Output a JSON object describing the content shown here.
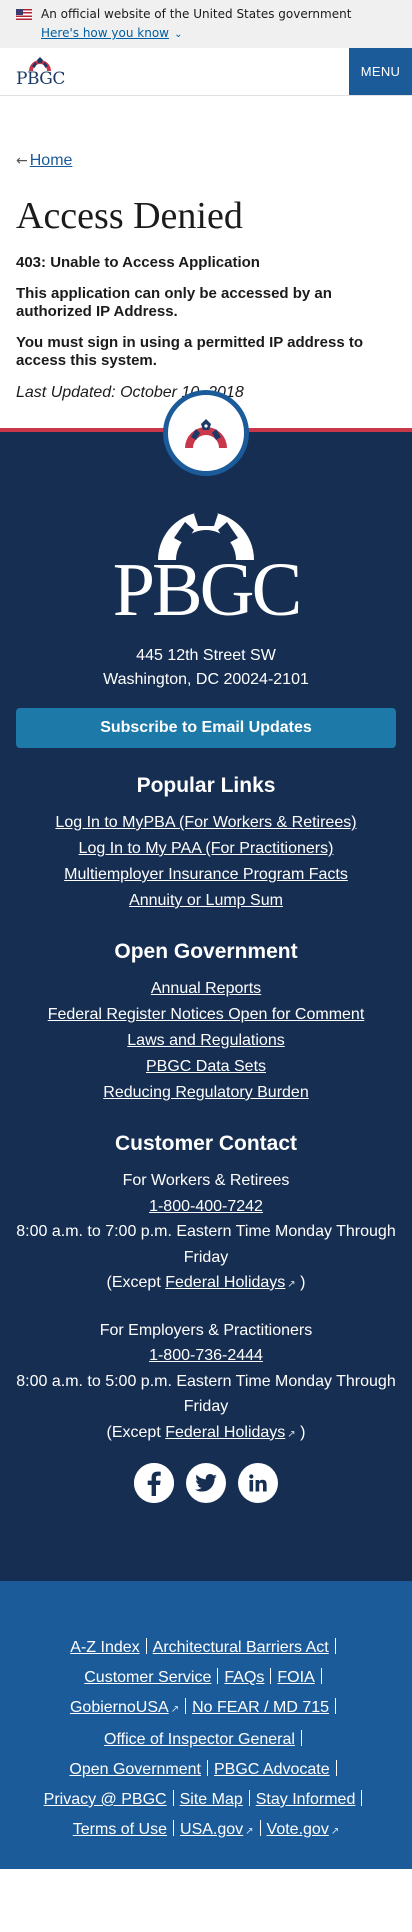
{
  "gov_banner": {
    "text": "An official website of the United States government",
    "link": "Here's how you know"
  },
  "header": {
    "logo_text": "PBGC",
    "menu_label": "MENU"
  },
  "breadcrumb": {
    "home": "Home"
  },
  "page": {
    "title": "Access Denied",
    "error_code": "403: Unable to Access Application",
    "message_1": "This application can only be accessed by an authorized IP Address.",
    "message_2": "You must sign in using a permitted IP address to access this system.",
    "last_updated": "Last Updated: October 10, 2018"
  },
  "footer": {
    "logo_text": "PBGC",
    "address_line_1": "445 12th Street SW",
    "address_line_2": "Washington, DC 20024-2101",
    "subscribe_label": "Subscribe to Email Updates",
    "popular_links": {
      "heading": "Popular Links",
      "items": [
        "Log In to MyPBA (For Workers & Retirees)",
        "Log In to My PAA (For Practitioners)",
        "Multiemployer Insurance Program Facts",
        "Annuity or Lump Sum"
      ]
    },
    "open_government": {
      "heading": "Open Government",
      "items": [
        "Annual Reports",
        "Federal Register Notices Open for Comment",
        "Laws and Regulations",
        "PBGC Data Sets",
        "Reducing Regulatory Burden"
      ]
    },
    "customer_contact": {
      "heading": "Customer Contact",
      "workers": {
        "label": "For Workers & Retirees",
        "phone": "1-800-400-7242",
        "hours": "8:00 a.m. to 7:00 p.m. Eastern Time Monday Through Friday",
        "except_prefix": "(Except",
        "holidays": "Federal Holidays",
        "except_suffix": ")"
      },
      "employers": {
        "label": "For Employers & Practitioners",
        "phone": "1-800-736-2444",
        "hours": "8:00 a.m. to 5:00 p.m. Eastern Time Monday Through Friday",
        "except_prefix": "(Except",
        "holidays": "Federal Holidays",
        "except_suffix": ")"
      }
    },
    "social": [
      "facebook-icon",
      "twitter-icon",
      "linkedin-icon"
    ],
    "bottom_links": {
      "l1": "A-Z Index",
      "l2": "Architectural Barriers Act",
      "l3": "Customer Service",
      "l4": "FAQs",
      "l5": "FOIA",
      "l6": "GobiernoUSA",
      "l7": "No FEAR / MD 715",
      "l8": "Office of Inspector General",
      "l9": "Open Government",
      "l10": "PBGC Advocate",
      "l11": "Privacy @ PBGC",
      "l12": "Site Map",
      "l13": "Stay Informed",
      "l14": "Terms of Use",
      "l15": "USA.gov",
      "l16": "Vote.gov"
    }
  },
  "colors": {
    "navy": "#162e51",
    "blue": "#1b5b9a",
    "red": "#c9374a",
    "subscribe": "#1d7aa8"
  }
}
